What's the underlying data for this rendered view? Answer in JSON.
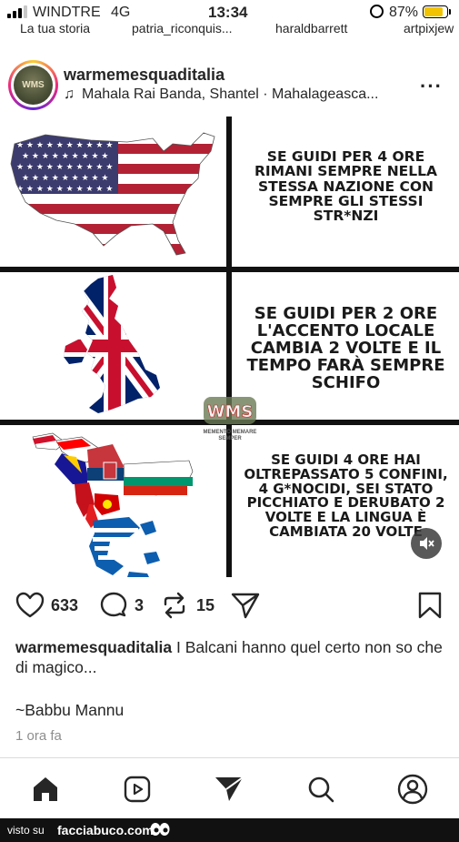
{
  "status_bar": {
    "carrier": "WINDTRE",
    "network": "4G",
    "time": "13:34",
    "battery_percent": "87%",
    "battery_level": 0.87,
    "battery_color": "#f2c300"
  },
  "stories": [
    "La tua storia",
    "patria_riconquis...",
    "haraldbarrett",
    "artpixjew"
  ],
  "post": {
    "username": "warmemesquaditalia",
    "music": "Mahala Rai Banda, Shantel · Mahalageasca...",
    "avatar_text": "WMS",
    "panels": [
      {
        "text": "SE GUIDI PER 4 ORE RIMANI SEMPRE NELLA STESSA NAZIONE CON SEMPRE GLI STESSI STR*NZI",
        "map": "usa-flag-map"
      },
      {
        "text": "SE GUIDI PER 2 ORE L'ACCENTO LOCALE CAMBIA 2 VOLTE E IL TEMPO FARÀ SEMPRE SCHIFO",
        "map": "uk-flag-map"
      },
      {
        "text": "SE GUIDI 4 ORE HAI OLTREPASSATO 5 CONFINI, 4 G*NOCIDI, SEI STATO PICCHIATO E DERUBATO 2 VOLTE E LA LINGUA È CAMBIATA 20 VOLTE",
        "map": "balkans-flags-map"
      }
    ],
    "watermark_text": "WMS",
    "watermark_sub": "MEMENTO MEMARE SEMPER"
  },
  "actions": {
    "likes": "633",
    "comments": "3",
    "reposts": "15"
  },
  "caption": {
    "username": "warmemesquaditalia",
    "text": "I Balcani hanno quel certo non so che di magico...",
    "signature": "~Babbu Mannu",
    "time_ago": "1 ora fa"
  },
  "nav": [
    "home-icon",
    "reels-icon",
    "send-icon",
    "search-icon",
    "profile-icon"
  ],
  "footer": {
    "prefix": "visto su",
    "site": "facciabuco.com"
  }
}
